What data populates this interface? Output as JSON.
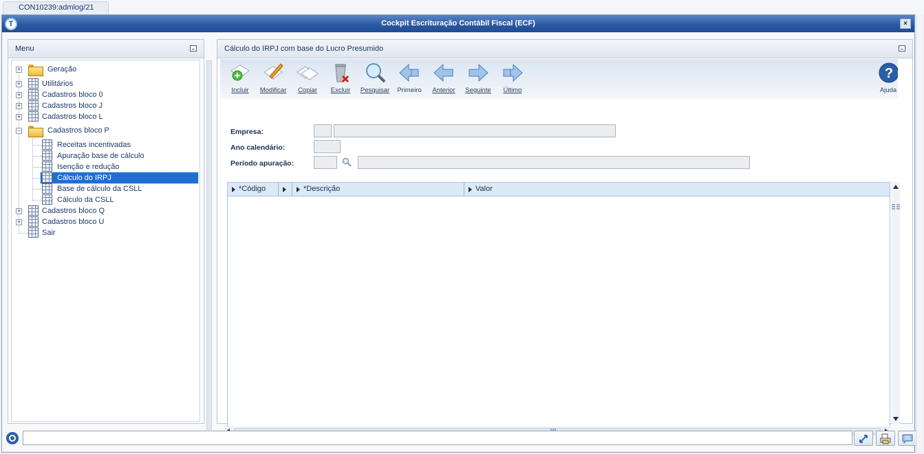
{
  "tab": {
    "label": "CON10239:admlog/21"
  },
  "window": {
    "title": "Cockpit Escrituração Contábil Fiscal (ECF)",
    "close_glyph": "×"
  },
  "menu": {
    "title": "Menu",
    "items": [
      {
        "label": "Geração",
        "icon": "folder-icon"
      },
      {
        "label": "Utilitários",
        "icon": "grid-icon"
      },
      {
        "label": "Cadastros bloco 0",
        "icon": "grid-icon"
      },
      {
        "label": "Cadastros bloco J",
        "icon": "grid-icon"
      },
      {
        "label": "Cadastros bloco L",
        "icon": "grid-icon"
      },
      {
        "label": "Cadastros bloco P",
        "icon": "folder-open-icon",
        "children": [
          {
            "label": "Receitas incentivadas"
          },
          {
            "label": "Apuração base de cálculo"
          },
          {
            "label": "Isenção e redução"
          },
          {
            "label": "Cálculo do IRPJ",
            "selected": true
          },
          {
            "label": "Base de cálculo da CSLL"
          },
          {
            "label": "Cálculo da CSLL"
          }
        ]
      },
      {
        "label": "Cadastros bloco Q",
        "icon": "grid-icon"
      },
      {
        "label": "Cadastros bloco U",
        "icon": "grid-icon"
      },
      {
        "label": "Sair",
        "icon": "grid-icon"
      }
    ]
  },
  "form": {
    "title": "Cálculo do IRPJ com base do Lucro Presumido",
    "toolbar": [
      {
        "label": "Incluir",
        "icon": "add-icon"
      },
      {
        "label": "Modificar",
        "icon": "edit-icon"
      },
      {
        "label": "Copiar",
        "icon": "copy-icon"
      },
      {
        "label": "Excluir",
        "icon": "delete-icon"
      },
      {
        "label": "Pesquisar",
        "icon": "search-icon"
      },
      {
        "label": "Primeiro",
        "icon": "first-icon"
      },
      {
        "label": "Anterior",
        "icon": "previous-icon"
      },
      {
        "label": "Seguinte",
        "icon": "next-icon"
      },
      {
        "label": "Último",
        "icon": "last-icon"
      },
      {
        "label": "Ajuda",
        "icon": "help-icon"
      }
    ],
    "fields": {
      "empresa_label": "Empresa:",
      "ano_label": "Ano calendário:",
      "periodo_label": "Período apuração:"
    },
    "grid": {
      "columns": [
        "*Código",
        "*Descrição",
        "Valor"
      ]
    }
  },
  "colors": {
    "accent": "#1f4c94",
    "selection": "#1f6fd2"
  }
}
